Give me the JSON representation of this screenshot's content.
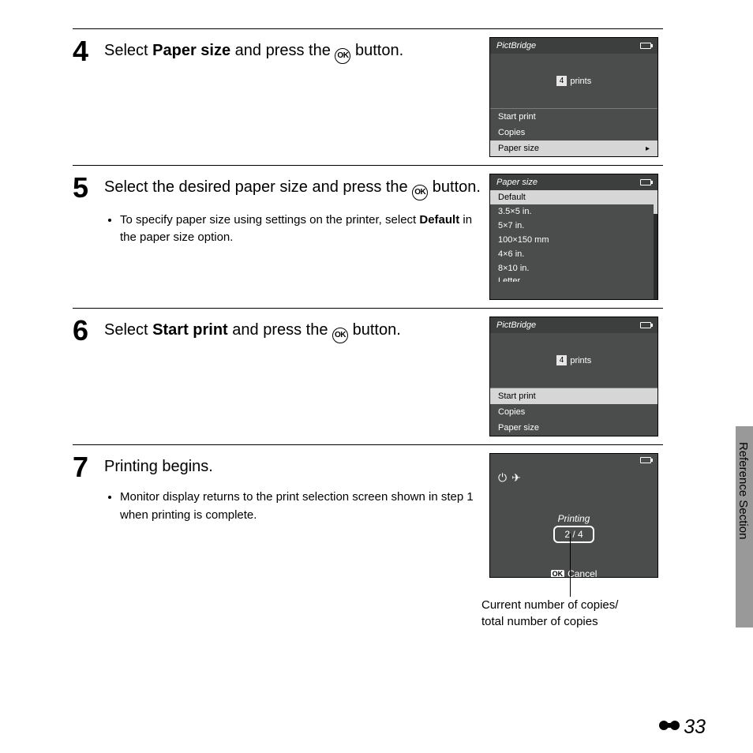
{
  "steps": {
    "s4": {
      "num": "4",
      "title_pre": "Select ",
      "title_bold": "Paper size",
      "title_post": " and press the ",
      "title_after_ok": " button.",
      "lcd": {
        "header": "PictBridge",
        "count": "4",
        "prints_label": " prints",
        "rows": [
          "Start print",
          "Copies"
        ],
        "selected": "Paper size",
        "arrow": "▸"
      }
    },
    "s5": {
      "num": "5",
      "title_pre": "Select the desired paper size and press the ",
      "title_after_ok": " button.",
      "bullet_pre": "To specify paper size using settings on the printer, select ",
      "bullet_bold": "Default",
      "bullet_post": " in the paper size option.",
      "lcd": {
        "header": "Paper size",
        "selected": "Default",
        "rows": [
          "3.5×5 in.",
          "5×7 in.",
          "100×150 mm",
          "4×6 in.",
          "8×10 in."
        ],
        "last_cut": "Letter"
      }
    },
    "s6": {
      "num": "6",
      "title_pre": "Select ",
      "title_bold": "Start print",
      "title_post": " and press the ",
      "title_after_ok": " button.",
      "lcd": {
        "header": "PictBridge",
        "count": "4",
        "prints_label": " prints",
        "selected": "Start print",
        "rows": [
          "Copies",
          "Paper size"
        ]
      }
    },
    "s7": {
      "num": "7",
      "title": "Printing begins.",
      "bullet": "Monitor display returns to the print selection screen shown in step 1 when printing is complete.",
      "lcd": {
        "printing_label": "Printing",
        "counter": "2 / 4",
        "ok_chip": "OK",
        "cancel": "Cancel"
      },
      "callout": "Current number of copies/\ntotal number of copies"
    }
  },
  "side_label": "Reference Section",
  "page_number": "33",
  "ok_label": "OK"
}
